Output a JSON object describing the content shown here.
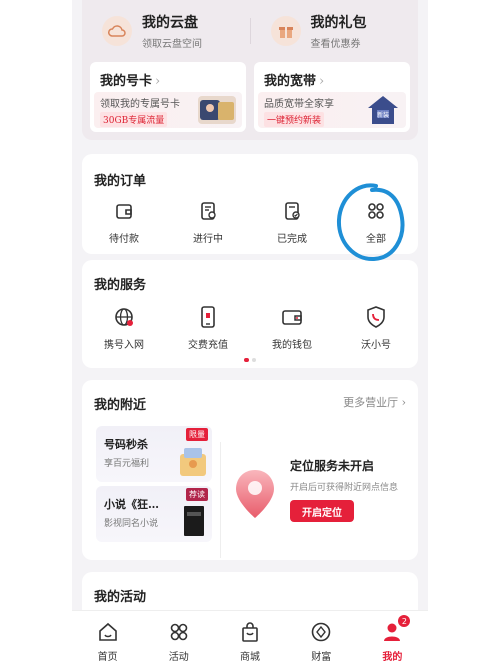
{
  "top": {
    "cloud": {
      "title": "我的云盘",
      "sub": "领取云盘空间",
      "icon": "cloud-icon"
    },
    "gift": {
      "title": "我的礼包",
      "sub": "查看优惠券",
      "icon": "gift-icon"
    }
  },
  "simcard": {
    "title": "我的号卡",
    "chevron": "›",
    "desc": "领取我的专属号卡",
    "tag": "30GB专属流量"
  },
  "broadband": {
    "title": "我的宽带",
    "chevron": "›",
    "desc": "品质宽带全家享",
    "tag": "一键预约新装",
    "img_text": "新装"
  },
  "orders": {
    "title": "我的订单",
    "items": [
      {
        "label": "待付款",
        "icon": "wallet-icon"
      },
      {
        "label": "进行中",
        "icon": "clock-doc-icon"
      },
      {
        "label": "已完成",
        "icon": "check-doc-icon"
      },
      {
        "label": "全部",
        "icon": "grid-icon"
      }
    ]
  },
  "services": {
    "title": "我的服务",
    "items": [
      {
        "label": "携号入网",
        "icon": "globe-icon"
      },
      {
        "label": "交费充值",
        "icon": "phone-pay-icon"
      },
      {
        "label": "我的钱包",
        "icon": "wallet-icon"
      },
      {
        "label": "沃小号",
        "icon": "shield-phone-icon"
      }
    ]
  },
  "nearby": {
    "title": "我的附近",
    "more": "更多营业厅",
    "more_chevron": "›",
    "promo1": {
      "title": "号码秒杀",
      "sub": "享百元福利",
      "badge": "限量"
    },
    "promo2": {
      "title": "小说《狂…",
      "sub": "影视同名小说",
      "badge": "荐读"
    },
    "location_title": "定位服务未开启",
    "location_sub": "开启后可获得附近网点信息",
    "location_button": "开启定位"
  },
  "activity": {
    "title": "我的活动"
  },
  "tabbar": {
    "tabs": [
      {
        "label": "首页",
        "icon": "home-icon"
      },
      {
        "label": "活动",
        "icon": "grid-icon"
      },
      {
        "label": "商城",
        "icon": "bag-icon"
      },
      {
        "label": "财富",
        "icon": "coin-icon"
      },
      {
        "label": "我的",
        "icon": "user-icon",
        "badge": "2",
        "active": true
      }
    ]
  },
  "colors": {
    "accent": "#e5203a",
    "annotation": "#1f8fd6"
  }
}
